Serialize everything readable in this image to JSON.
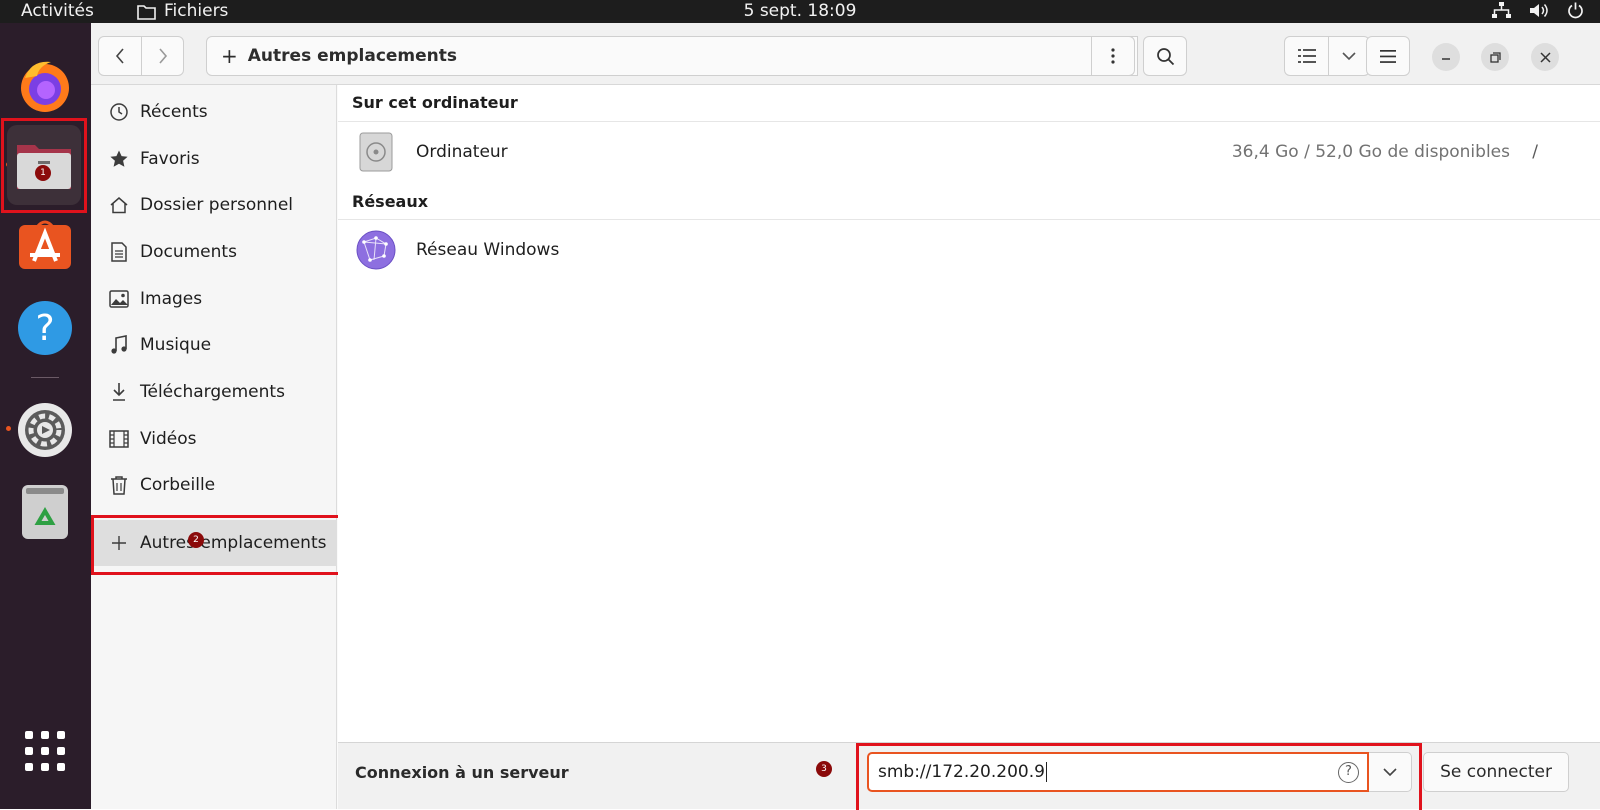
{
  "topbar": {
    "activities": "Activités",
    "app_name": "Fichiers",
    "clock": "5 sept.  18:09"
  },
  "dock": {
    "items": [
      "firefox-icon",
      "files-icon",
      "app-center-icon",
      "help-icon",
      "settings-icon",
      "trash-icon",
      "app-grid-icon"
    ]
  },
  "annotations": {
    "badge1": "1",
    "badge2": "2",
    "badge3": "3"
  },
  "headerbar": {
    "path_plus": "+",
    "path_label": "Autres emplacements"
  },
  "sidebar": {
    "items": [
      {
        "label": "Récents",
        "icon": "clock-icon"
      },
      {
        "label": "Favoris",
        "icon": "star-icon"
      },
      {
        "label": "Dossier personnel",
        "icon": "home-icon"
      },
      {
        "label": "Documents",
        "icon": "document-icon"
      },
      {
        "label": "Images",
        "icon": "image-icon"
      },
      {
        "label": "Musique",
        "icon": "music-icon"
      },
      {
        "label": "Téléchargements",
        "icon": "download-icon"
      },
      {
        "label": "Vidéos",
        "icon": "video-icon"
      },
      {
        "label": "Corbeille",
        "icon": "trash-icon"
      }
    ],
    "other_locations": "Autres emplacements"
  },
  "main": {
    "section_computer": "Sur cet ordinateur",
    "computer_label": "Ordinateur",
    "computer_space": "36,4 Go / 52,0 Go de disponibles",
    "computer_mount": "/",
    "section_network": "Réseaux",
    "network_label": "Réseau Windows"
  },
  "actionbar": {
    "label": "Connexion à un serveur",
    "server_value": "smb://172.20.200.9",
    "help": "?",
    "connect_label": "Se connecter"
  },
  "colors": {
    "accent": "#e95420",
    "highlight_box": "#e0121c",
    "badge": "#8b0a0a"
  }
}
